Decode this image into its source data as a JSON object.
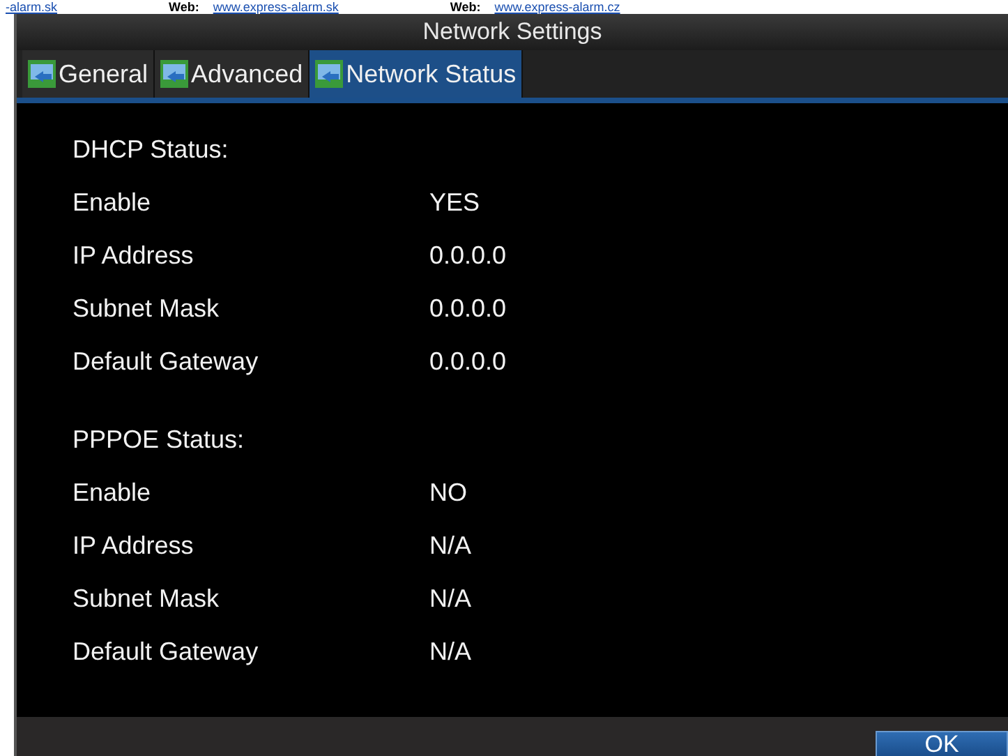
{
  "header_links": [
    {
      "kind": "link",
      "text": "-alarm.sk"
    },
    {
      "kind": "label",
      "text": "Web:"
    },
    {
      "kind": "link",
      "text": "www.express-alarm.sk"
    },
    {
      "kind": "label",
      "text": "Web:"
    },
    {
      "kind": "link",
      "text": "www.express-alarm.cz"
    }
  ],
  "window": {
    "title": "Network Settings"
  },
  "tabs": [
    {
      "label": "General",
      "selected": false
    },
    {
      "label": "Advanced",
      "selected": false
    },
    {
      "label": "Network Status",
      "selected": true
    }
  ],
  "sections": [
    {
      "heading": "DHCP Status:",
      "rows": [
        {
          "label": "Enable",
          "value": "YES"
        },
        {
          "label": "IP Address",
          "value": "0.0.0.0"
        },
        {
          "label": "Subnet Mask",
          "value": "0.0.0.0"
        },
        {
          "label": "Default Gateway",
          "value": "0.0.0.0"
        }
      ]
    },
    {
      "heading": "PPPOE Status:",
      "rows": [
        {
          "label": "Enable",
          "value": "NO"
        },
        {
          "label": "IP Address",
          "value": "N/A"
        },
        {
          "label": "Subnet Mask",
          "value": "N/A"
        },
        {
          "label": "Default Gateway",
          "value": "N/A"
        }
      ]
    }
  ],
  "buttons": [
    "OK"
  ]
}
